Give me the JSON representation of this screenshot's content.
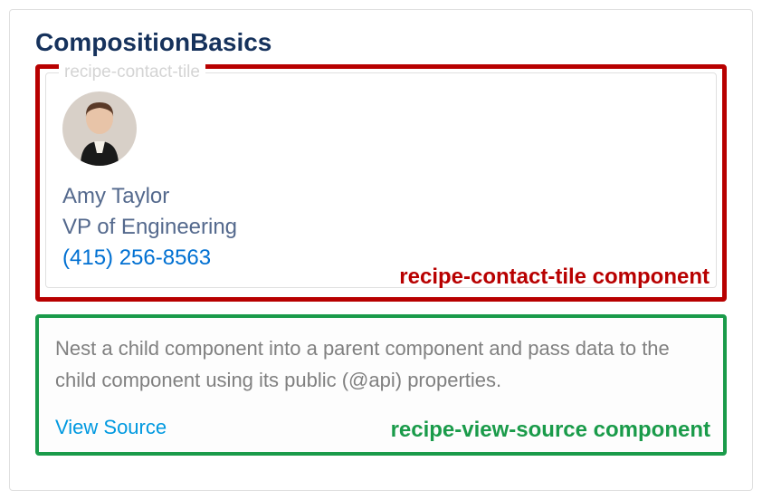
{
  "header": {
    "title": "CompositionBasics"
  },
  "contactTile": {
    "legend": "recipe-contact-tile",
    "name": "Amy Taylor",
    "jobTitle": "VP of Engineering",
    "phone": "(415) 256-8563",
    "annotationLabel": "recipe-contact-tile component"
  },
  "viewSource": {
    "description": "Nest a child component into a parent component and pass data to the child component using its public (@api) properties.",
    "linkText": "View Source",
    "annotationLabel": "recipe-view-source component"
  },
  "colors": {
    "titleBlue": "#16325c",
    "mutedText": "#54698d",
    "linkBlue": "#0070d2",
    "redBox": "#b80000",
    "greenBox": "#1a9b4a",
    "grayText": "#808080"
  }
}
